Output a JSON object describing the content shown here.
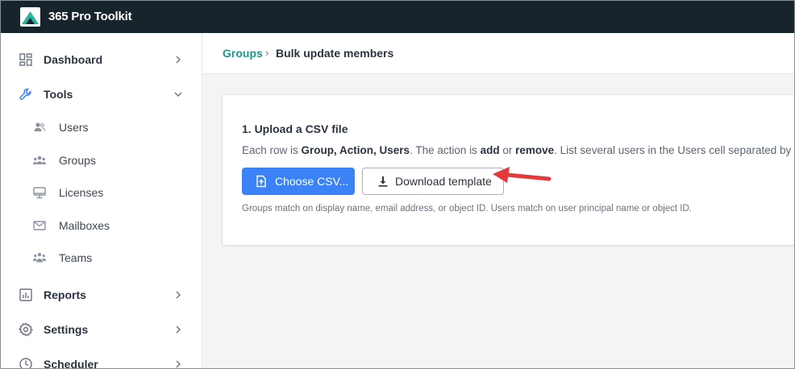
{
  "app": {
    "title": "365 Pro Toolkit"
  },
  "colors": {
    "topbar": "#17242b",
    "accent": "#1b9a8c",
    "primary_button": "#3b82f6",
    "annotation_arrow": "#e5383b"
  },
  "sidebar": {
    "items": [
      {
        "label": "Dashboard",
        "icon": "dashboard-icon",
        "chevron": "chevron-right-icon"
      },
      {
        "label": "Tools",
        "icon": "wrench-icon",
        "chevron": "chevron-down-icon"
      },
      {
        "label": "Reports",
        "icon": "reports-icon",
        "chevron": "chevron-right-icon"
      },
      {
        "label": "Settings",
        "icon": "gear-icon",
        "chevron": "chevron-right-icon"
      },
      {
        "label": "Scheduler",
        "icon": "clock-icon",
        "chevron": "chevron-right-icon"
      }
    ],
    "tools_subitems": [
      {
        "label": "Users",
        "icon": "users-icon"
      },
      {
        "label": "Groups",
        "icon": "groups-icon"
      },
      {
        "label": "Licenses",
        "icon": "monitor-icon"
      },
      {
        "label": "Mailboxes",
        "icon": "mail-icon"
      },
      {
        "label": "Teams",
        "icon": "teams-icon"
      }
    ]
  },
  "breadcrumb": {
    "link": "Groups",
    "separator": "›",
    "current": "Bulk update members"
  },
  "upload_card": {
    "title": "1. Upload a CSV file",
    "desc_prefix": "Each row is ",
    "desc_columns": "Group, Action, Users",
    "desc_mid": ". The action is ",
    "desc_add": "add",
    "desc_or": " or ",
    "desc_remove": "remove",
    "desc_suffix": ". List several users in the Users cell separated by",
    "choose_button": "Choose CSV...",
    "download_button": "Download template",
    "note": "Groups match on display name, email address, or object ID. Users match on user principal name or object ID."
  }
}
